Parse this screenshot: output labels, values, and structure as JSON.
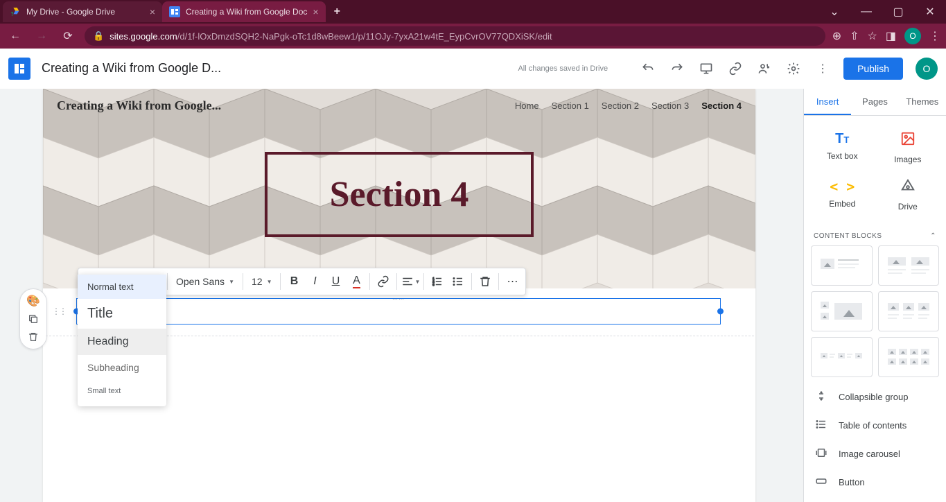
{
  "browser": {
    "tabs": [
      {
        "title": "My Drive - Google Drive",
        "active": false
      },
      {
        "title": "Creating a Wiki from Google Doc",
        "active": true
      }
    ],
    "url_host": "sites.google.com",
    "url_path": "/d/1f-lOxDmzdSQH2-NaPgk-oTc1d8wBeew1/p/11OJy-7yxA21w4tE_EypCvrOV77QDXiSK/edit",
    "profile_initial": "O"
  },
  "app": {
    "doc_title": "Creating a Wiki from Google D...",
    "save_status": "All changes saved in Drive",
    "publish_label": "Publish",
    "avatar_initial": "O"
  },
  "hero": {
    "site_title": "Creating a Wiki from Google...",
    "nav": [
      "Home",
      "Section 1",
      "Section 2",
      "Section 3",
      "Section 4"
    ],
    "nav_active_index": 4,
    "page_title": "Section 4"
  },
  "toolbar": {
    "style_label": "Normal text",
    "font_label": "Open Sans",
    "font_size": "12"
  },
  "style_dropdown": {
    "items": [
      {
        "label": "Normal text",
        "class": "selected"
      },
      {
        "label": "Title",
        "class": "title"
      },
      {
        "label": "Heading",
        "class": "heading"
      },
      {
        "label": "Subheading",
        "class": "sub"
      },
      {
        "label": "Small text",
        "class": "small"
      }
    ]
  },
  "sidebar": {
    "tabs": [
      "Insert",
      "Pages",
      "Themes"
    ],
    "active_tab_index": 0,
    "quick": [
      {
        "label": "Text box",
        "icon": "Tᴛ",
        "color": "#1a73e8"
      },
      {
        "label": "Images",
        "icon": "▣",
        "color": "#ea4335"
      },
      {
        "label": "Embed",
        "icon": "< >",
        "color": "#fbbc04"
      },
      {
        "label": "Drive",
        "icon": "△",
        "color": "#5f6368"
      }
    ],
    "content_blocks_label": "CONTENT BLOCKS",
    "insert_rows": [
      {
        "label": "Collapsible group",
        "icon": "⇕"
      },
      {
        "label": "Table of contents",
        "icon": "≡"
      },
      {
        "label": "Image carousel",
        "icon": "❐"
      },
      {
        "label": "Button",
        "icon": "▭"
      }
    ]
  }
}
